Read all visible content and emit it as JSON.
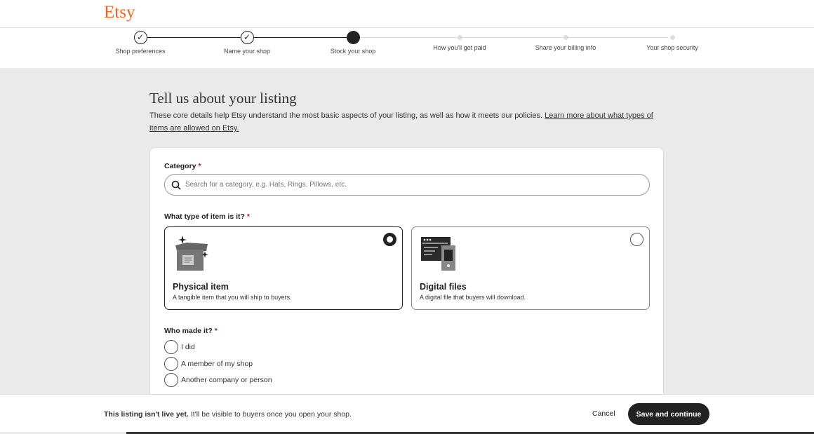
{
  "header": {
    "logo": "Etsy"
  },
  "steps": [
    {
      "label": "Shop preferences",
      "state": "done"
    },
    {
      "label": "Name your shop",
      "state": "done"
    },
    {
      "label": "Stock your shop",
      "state": "current"
    },
    {
      "label": "How you'll get paid",
      "state": "todo"
    },
    {
      "label": "Share your billing info",
      "state": "todo"
    },
    {
      "label": "Your shop security",
      "state": "todo"
    }
  ],
  "main": {
    "title": "Tell us about your listing",
    "description": "These core details help Etsy understand the most basic aspects of your listing, as well as how it meets our policies. ",
    "link": "Learn more about what types of items are allowed on Etsy."
  },
  "form": {
    "category_label": "Category",
    "required_mark": "*",
    "category_placeholder": "Search for a category, e.g. Hats, Rings, Pillows, etc.",
    "type_label": "What type of item is it?",
    "types": [
      {
        "name": "Physical item",
        "sub": "A tangible item that you will ship to buyers.",
        "selected": true
      },
      {
        "name": "Digital files",
        "sub": "A digital file that buyers will download.",
        "selected": false
      }
    ],
    "maker_label": "Who made it?",
    "makers": [
      "I did",
      "A member of my shop",
      "Another company or person"
    ]
  },
  "footer": {
    "bold": "This listing isn't live yet.",
    "msg": " It'll be visible to buyers once you open your shop.",
    "cancel": "Cancel",
    "save": "Save and continue"
  },
  "colors": {
    "brand": "#f1641e",
    "primary": "#222222",
    "required": "#a61a2e"
  }
}
